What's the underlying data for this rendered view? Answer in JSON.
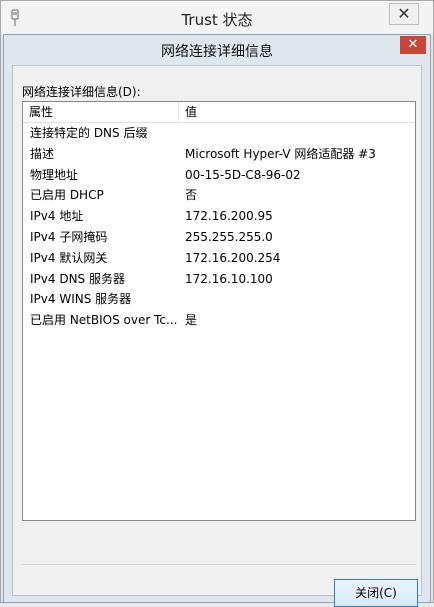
{
  "outer_window": {
    "title": "Trust 状态",
    "close_label": "✕"
  },
  "dialog": {
    "title": "网络连接详细信息",
    "close_label": "✕",
    "section_label": "网络连接详细信息(D):",
    "columns": {
      "property": "属性",
      "value": "值"
    },
    "rows": [
      {
        "property": "连接特定的 DNS 后缀",
        "value": ""
      },
      {
        "property": "描述",
        "value": "Microsoft Hyper-V 网络适配器 #3"
      },
      {
        "property": "物理地址",
        "value": "00-15-5D-C8-96-02"
      },
      {
        "property": "已启用 DHCP",
        "value": "否"
      },
      {
        "property": "IPv4 地址",
        "value": "172.16.200.95"
      },
      {
        "property": "IPv4 子网掩码",
        "value": "255.255.255.0"
      },
      {
        "property": "IPv4 默认网关",
        "value": "172.16.200.254"
      },
      {
        "property": "IPv4 DNS 服务器",
        "value": "172.16.10.100"
      },
      {
        "property": "IPv4 WINS 服务器",
        "value": ""
      },
      {
        "property": "已启用 NetBIOS over Tc...",
        "value": "是"
      }
    ],
    "close_button_label": "关闭(C)"
  },
  "colors": {
    "dialog_close_bg": "#c6463a",
    "button_border": "#2b7fd1"
  }
}
